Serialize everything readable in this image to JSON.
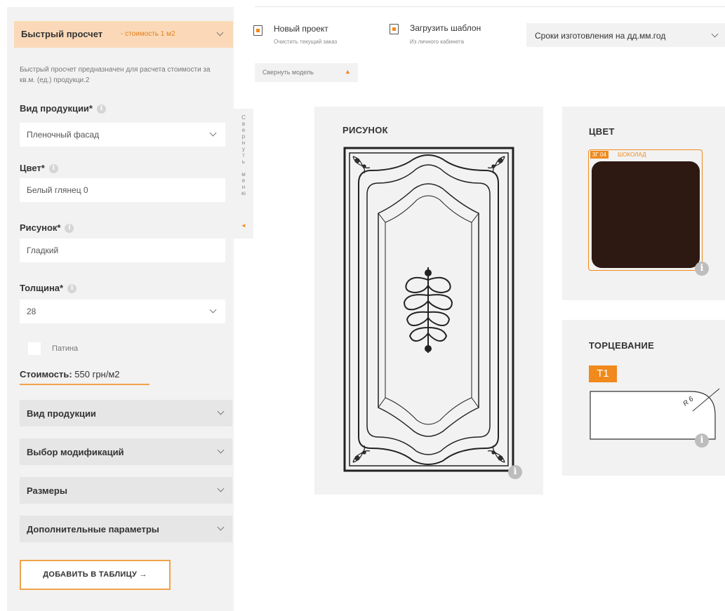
{
  "left_panel": {
    "quick_calc": {
      "title": "Быстрый просчет",
      "subtitle": "- стоимость 1 м2"
    },
    "description": "Быстрый просчет предназначен для расчета стоимости за кв.м. (ед.) продукци.2",
    "product_type": {
      "label": "Вид продукции*",
      "value": "Пленочный фасад"
    },
    "color": {
      "label": "Цвет*",
      "value": "Белый глянец 0"
    },
    "pattern": {
      "label": "Рисунок*",
      "value": "Гладкий"
    },
    "thickness": {
      "label": "Толщина*",
      "value": "28"
    },
    "patina_label": "Патина",
    "cost": {
      "label": "Стоимость:",
      "value": "550 грн/м2"
    },
    "accordions": [
      "Вид продукции",
      "Выбор модификаций",
      "Размеры",
      "Дополнительные параметры"
    ],
    "add_button": "ДОБАВИТЬ В ТАБЛИЦУ →"
  },
  "collapse_menu": {
    "letters": "С\nв\nе\nр\nн\nу\nт\nь\n \nм\nе\nн\nю",
    "arrow": "◄"
  },
  "toolbar": {
    "new_project": {
      "title": "Новый проект",
      "subtitle": "Очистить текущий заказ"
    },
    "load_template": {
      "title": "Загрузить шаблон",
      "subtitle": "Из личного кабинета"
    },
    "deadline": "Сроки изготовления на дд.мм.год",
    "collapse_model": "Свернуть модель",
    "collapse_model_arrow": "▲"
  },
  "pattern_card": {
    "title": "РИСУНОК",
    "info": "i"
  },
  "color_card": {
    "title": "ЦВЕТ",
    "code": "3Г 04",
    "name": "ШОКОЛАД",
    "swatch_color": "#2e1812",
    "info": "i"
  },
  "edge_card": {
    "title": "ТОРЦЕВАНИЕ",
    "badge": "Т1",
    "radius_label": "R 6",
    "info": "i"
  },
  "colors": {
    "accent": "#f08a1c",
    "accent_light": "#fbd9b8",
    "panel_bg": "#f2f2f2"
  }
}
